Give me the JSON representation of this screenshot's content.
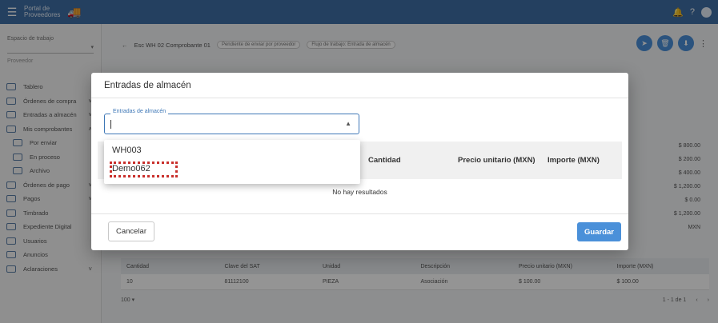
{
  "header": {
    "logo_line1": "Portal de",
    "logo_line2": "Proveedores",
    "menu_icon": "hamburger-icon",
    "right_icons": [
      "bell-icon",
      "help-icon",
      "avatar-icon"
    ]
  },
  "sidebar": {
    "workspace_label": "Espacio de trabajo",
    "provider_label": "Proveedor",
    "items": [
      {
        "label": "Tablero",
        "icon": "dashboard-icon",
        "chevron": ""
      },
      {
        "label": "Órdenes de compra",
        "icon": "clipboard-icon",
        "chevron": "˅"
      },
      {
        "label": "Entradas a almacén",
        "icon": "truck-icon",
        "chevron": "˅"
      },
      {
        "label": "Mis comprobantes",
        "icon": "document-icon",
        "chevron": "˄"
      },
      {
        "label": "Por enviar",
        "icon": "send-icon",
        "chevron": ""
      },
      {
        "label": "En proceso",
        "icon": "hourglass-icon",
        "chevron": ""
      },
      {
        "label": "Archivo",
        "icon": "archive-icon",
        "chevron": ""
      },
      {
        "label": "Órdenes de pago",
        "icon": "card-icon",
        "chevron": "˅"
      },
      {
        "label": "Pagos",
        "icon": "money-icon",
        "chevron": "˅"
      },
      {
        "label": "Timbrado",
        "icon": "building-icon",
        "chevron": ""
      },
      {
        "label": "Expediente Digital",
        "icon": "folder-icon",
        "chevron": ""
      },
      {
        "label": "Usuarios",
        "icon": "users-icon",
        "chevron": ""
      },
      {
        "label": "Anuncios",
        "icon": "bell-icon",
        "chevron": ""
      },
      {
        "label": "Aclaraciones",
        "icon": "mail-icon",
        "chevron": "˅"
      }
    ]
  },
  "main": {
    "breadcrumb_title": "Esc WH 02 Comprobante 01",
    "chip1": "Pendiente de enviar por proveedor",
    "chip2": "Flujo de trabajo: Entrada de almacén",
    "summary_values": [
      "$ 800.00",
      "$ 200.00",
      "$ 400.00",
      "$ 1,200.00",
      "$ 0.00",
      "$ 1,200.00",
      "MXN"
    ],
    "table": {
      "headers": [
        "Cantidad",
        "Clave del SAT",
        "Unidad",
        "Descripción",
        "Precio unitario (MXN)",
        "Importe (MXN)"
      ],
      "row": [
        "10",
        "81112100",
        "PIEZA",
        "Asociación",
        "$ 100.00",
        "$ 100.00"
      ]
    },
    "rows_per_page": "100",
    "pagination": "1 - 1 de 1"
  },
  "modal": {
    "title": "Entradas de almacén",
    "field_label": "Entradas de almacén",
    "field_value": "",
    "table_headers": [
      "Cantidad",
      "Precio unitario (MXN)",
      "Importe (MXN)"
    ],
    "no_results": "No hay resultados",
    "cancel_label": "Cancelar",
    "save_label": "Guardar"
  },
  "dropdown": {
    "options": [
      "WH003",
      "Demo062"
    ]
  },
  "colors": {
    "topbar": "#3f6fa6",
    "accent": "#4a90d9",
    "highlight": "#c9302c"
  }
}
